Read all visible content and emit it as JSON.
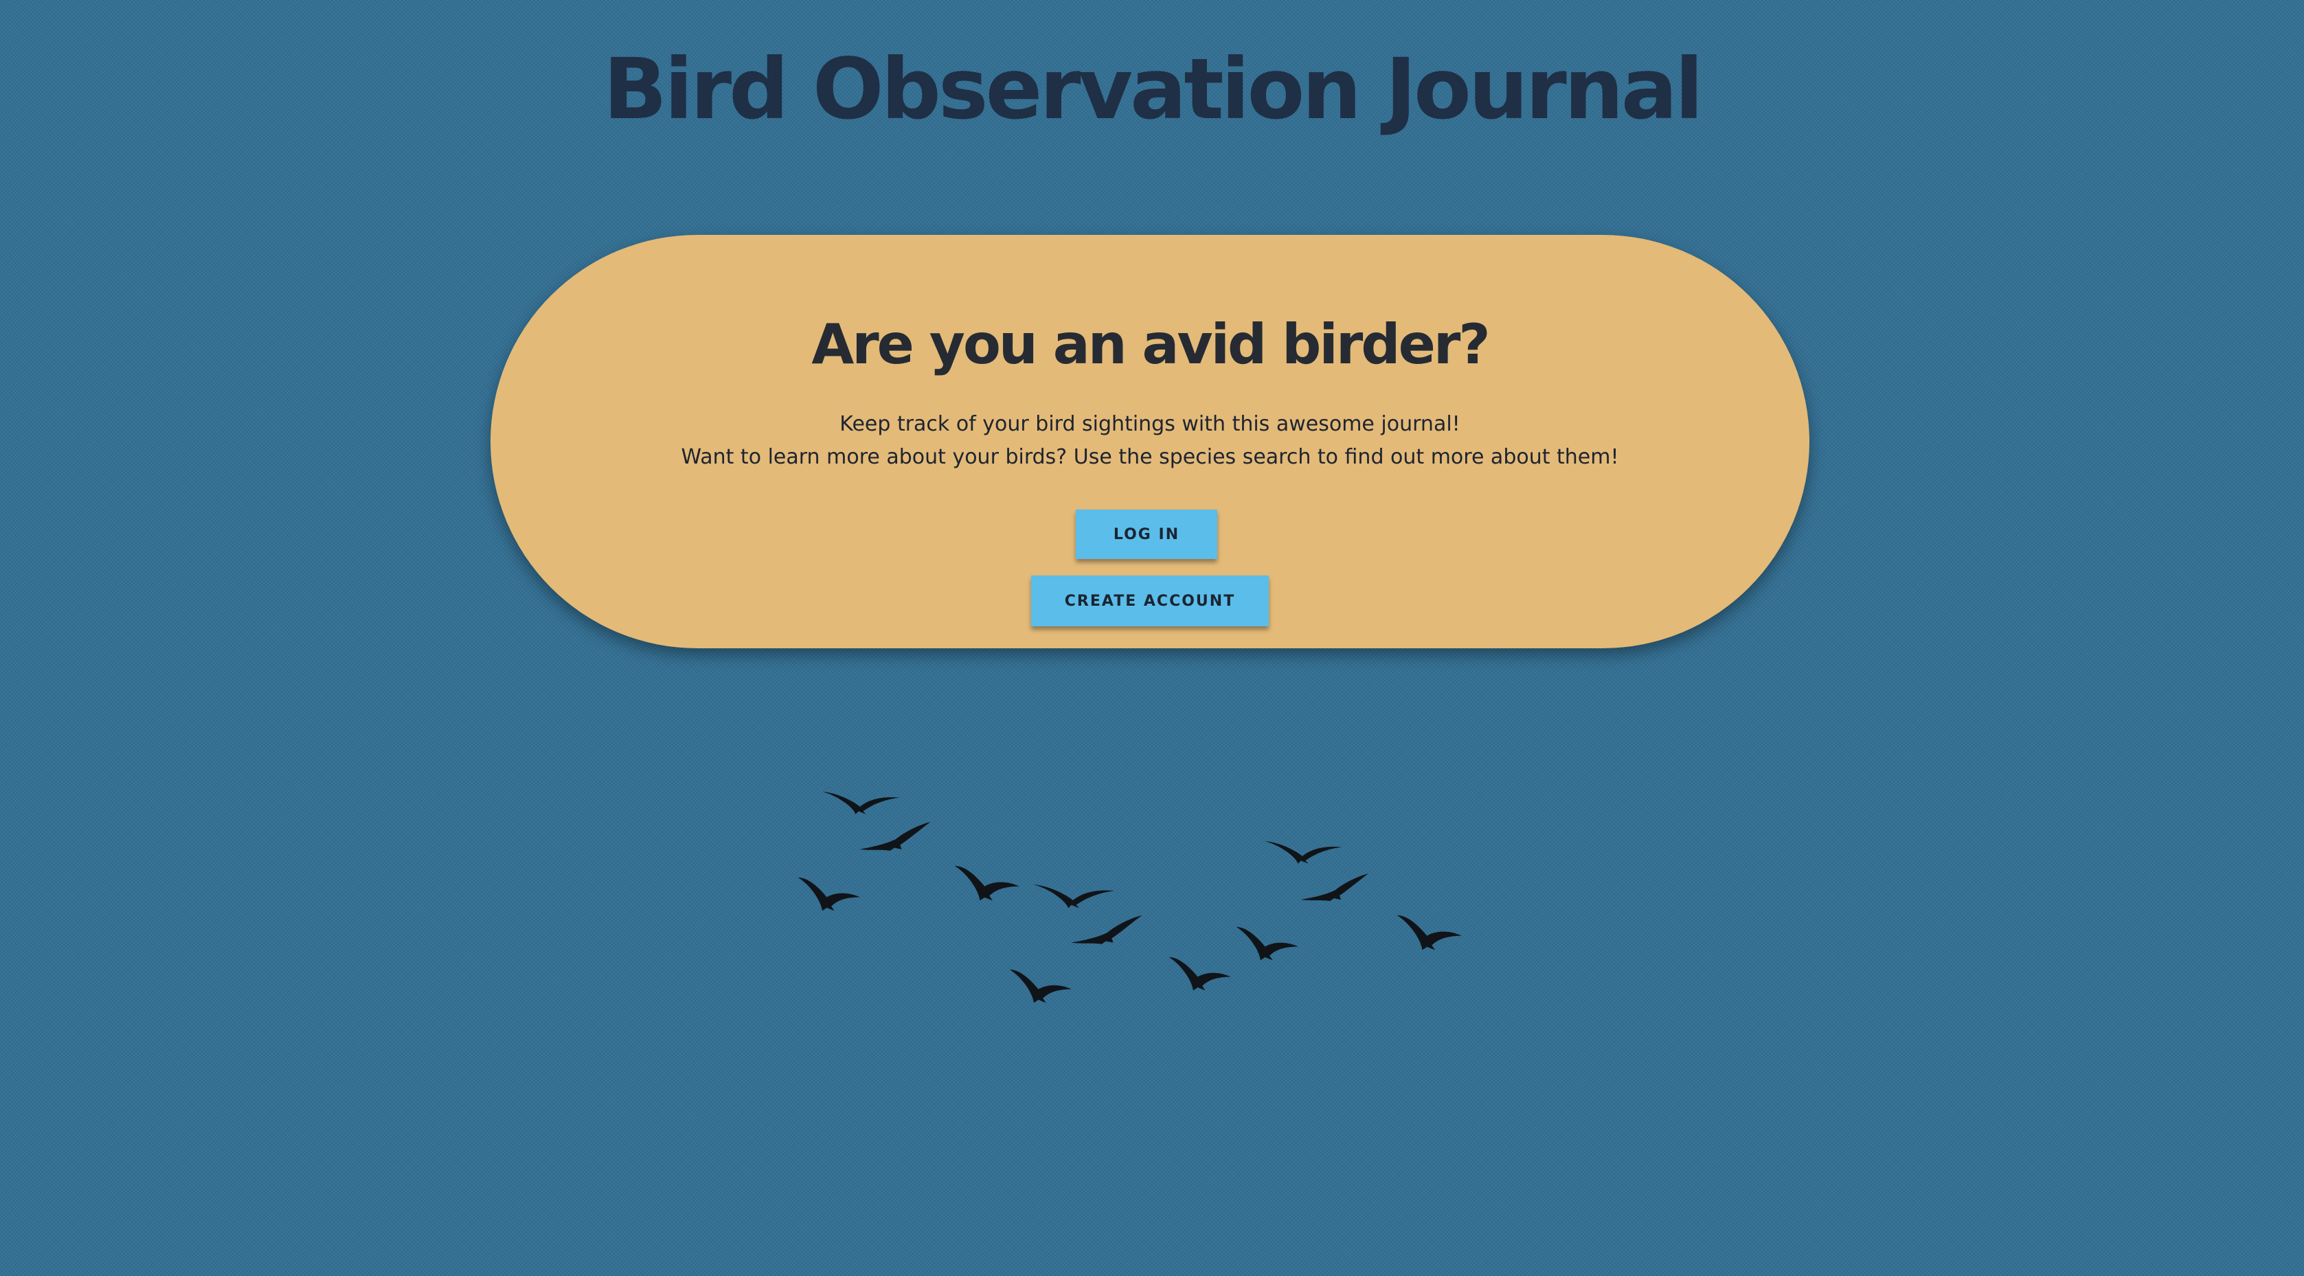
{
  "header": {
    "title": "Bird Observation Journal"
  },
  "hero": {
    "heading": "Are you an avid birder?",
    "line1": "Keep track of your bird sightings with this awesome journal!",
    "line2": "Want to learn more about your birds? Use the species search to find out more about them!",
    "login_label": "LOG IN",
    "create_label": "CREATE ACCOUNT"
  },
  "decoration": {
    "icon": "flying-birds-icon"
  },
  "colors": {
    "background": "#326f93",
    "card": "#e3ba78",
    "button": "#5bbde9",
    "title": "#1f2f45"
  }
}
